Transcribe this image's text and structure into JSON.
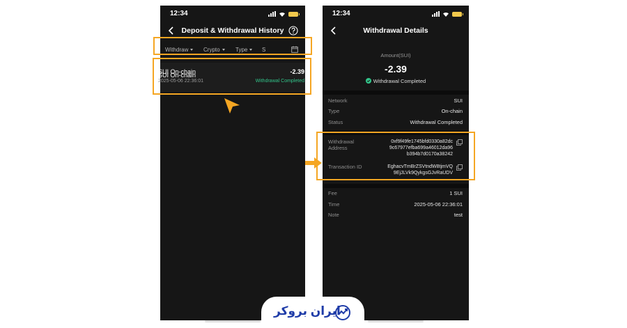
{
  "left_screen": {
    "status_time": "12:34",
    "title": "Deposit & Withdrawal History",
    "filters": [
      "Withdraw",
      "Crypto",
      "Type",
      "S"
    ],
    "record": {
      "title": "SUI On-chain",
      "amount": "-2.39",
      "date": "2025-05-06 22:36:01",
      "status": "Withdrawal Completed"
    }
  },
  "right_screen": {
    "status_time": "12:34",
    "title": "Withdrawal Details",
    "amount_label": "Amount(SUI)",
    "amount": "-2.39",
    "status": "Withdrawal Completed",
    "details": {
      "network_label": "Network",
      "network": "SUI",
      "type_label": "Type",
      "type": "On-chain",
      "status_label": "Status",
      "status": "Withdrawal Completed",
      "address_label_1": "Withdrawal",
      "address_label_2": "Address",
      "address_1": "0xf9f49fe1745bfd0330a82dc",
      "address_2": "9c67977efba699a46012da96",
      "address_3": "b394b7d0170a38242",
      "txid_label": "Transaction ID",
      "txid_1": "EghacvTmBrZSVtndW8tjmVQ",
      "txid_2": "9EjJLVk9QykgsGJvRaUDV",
      "fee_label": "Fee",
      "fee": "1 SUI",
      "time_label": "Time",
      "time": "2025-05-06 22:36:01",
      "note_label": "Note",
      "note": "test"
    }
  },
  "brand": {
    "logo_text": "ایران بروکر"
  },
  "colors": {
    "highlight": "#f5a623",
    "success": "#32c48a",
    "background": "#161616",
    "brand": "#1f3ca8"
  },
  "icons": [
    "back-arrow-icon",
    "help-icon",
    "calendar-icon",
    "check-circle-icon",
    "copy-icon",
    "signal-icon",
    "wifi-icon",
    "battery-icon",
    "pointer-arrow-icon",
    "right-arrow-icon",
    "brand-logo-icon"
  ]
}
